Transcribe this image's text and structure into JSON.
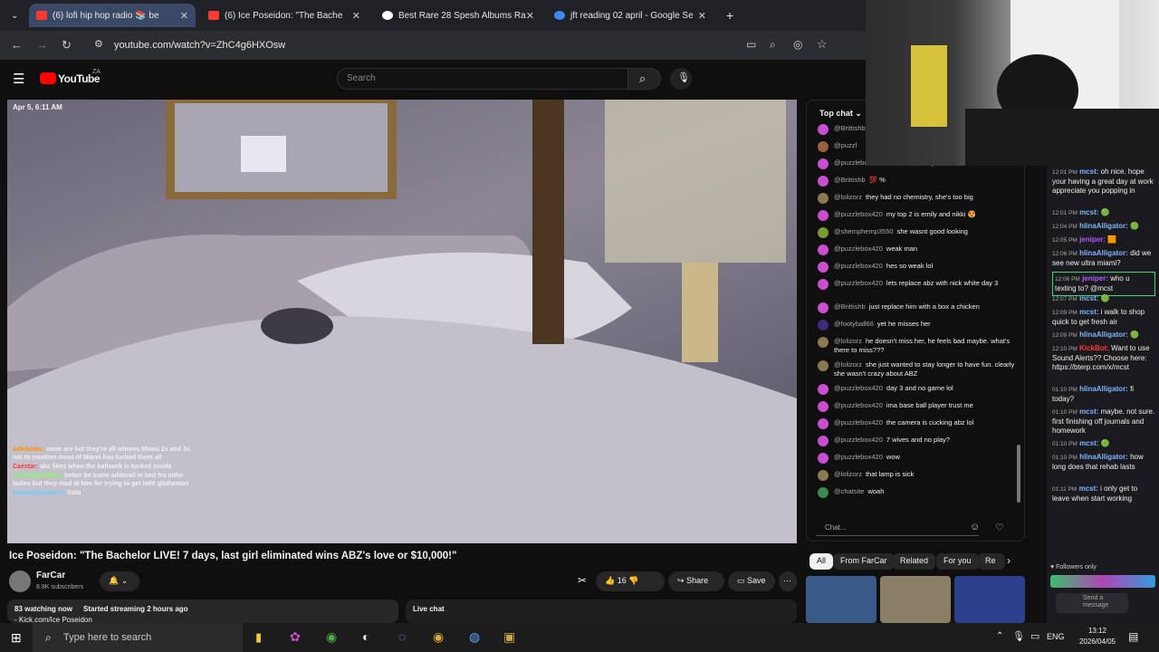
{
  "browser": {
    "tabs": [
      {
        "label": "(6) lofi hip hop radio 📚 be",
        "color": "#ff3b30",
        "active": true
      },
      {
        "label": "(6) Ice Poseidon: \"The Bache",
        "color": "#ff3b30",
        "active": false
      },
      {
        "label": "Best Rare 28 Spesh Albums Ra",
        "color": "#ffffff",
        "active": false
      },
      {
        "label": "jft reading 02 april - Google Se",
        "color": "#4285f4",
        "active": false
      }
    ],
    "url": "youtube.com/watch?v=ZhC4g6HXOsw"
  },
  "youtube": {
    "logo_text": "YouTube",
    "logo_region": "ZA",
    "search_placeholder": "Search"
  },
  "video": {
    "timestamp": "Apr 5, 6:11 AM",
    "overlay_chat": [
      {
        "user": "soleboots:",
        "text": " none are hot they're all whores Miami 2s and 3s not to mention most of Miami has fucked them all",
        "color": "#ff8a00"
      },
      {
        "user": "Caestar:",
        "text": " abz likes when the ballsack is tucked inside",
        "color": "#ff3b3b"
      },
      {
        "user": "TechniquePlays:",
        "text": " better be some adderall in bed fro mthe ladies but they mad at him for trying to get lwht glatheman",
        "color": "#7dff5a"
      },
      {
        "user": "cowboybynature:",
        "text": " Gula",
        "color": "#66ccff"
      }
    ],
    "title": "Ice Poseidon: \"The Bachelor LIVE! 7 days, last girl eliminated wins ABZ's love or $10,000!\"",
    "channel": "FarCar",
    "subscribers": "8.8K subscribers",
    "likes": "16",
    "share_label": "Share",
    "save_label": "Save",
    "watching": "83 watching now",
    "started": "Started streaming 2 hours ago",
    "desc_line": "- Kick.com/Ice Poseidon",
    "live_chat_label": "Live chat"
  },
  "livechat": {
    "header": "Top chat",
    "input_placeholder": "Chat...",
    "messages": [
      {
        "user": "@Brittishb",
        "text": ""
      },
      {
        "user": "@puzzl",
        "text": ""
      },
      {
        "user": "@puzzlebox420",
        "text": "abz is racist af yo"
      },
      {
        "user": "@Brittishb",
        "text": "💯 %"
      },
      {
        "user": "@lolizorz",
        "text": "they had no chemistry, she's too big"
      },
      {
        "user": "@puzzlebox420",
        "text": "my top 2 is emily and nikki 😍"
      },
      {
        "user": "@shemphemp3550",
        "text": "she wasnt good looking"
      },
      {
        "user": "@puzzlebox420",
        "text": "weak man"
      },
      {
        "user": "@puzzlebox420",
        "text": "hes so weak lol"
      },
      {
        "user": "@puzzlebox420",
        "text": "lets replace abz with nick white day 3"
      },
      {
        "user": "@Brittishb",
        "text": "just replace him with a box a chicken"
      },
      {
        "user": "@footyball66",
        "text": "yet he misses her"
      },
      {
        "user": "@lolizorz",
        "text": "he doesn't miss her, he feels bad maybe. what's there to miss???"
      },
      {
        "user": "@lolizorz",
        "text": "she just wanted to stay longer to have fun. clearly she wasn't crazy about ABZ"
      },
      {
        "user": "@puzzlebox420",
        "text": "day 3 and no game lol"
      },
      {
        "user": "@puzzlebox420",
        "text": "ima base ball player trust me"
      },
      {
        "user": "@puzzlebox420",
        "text": "the camera is cucking abz lol"
      },
      {
        "user": "@puzzlebox420",
        "text": "7 wives and no play?"
      },
      {
        "user": "@puzzlebox420",
        "text": "wow"
      },
      {
        "user": "@lolizorz",
        "text": "that lamp is sick"
      },
      {
        "user": "@chatsite",
        "text": "woah"
      }
    ],
    "chips": [
      "All",
      "From FarCar",
      "Related",
      "For you",
      "Re"
    ]
  },
  "streamchat": {
    "lines": [
      {
        "time": "12:01 PM",
        "user": "mcst:",
        "text": " oh nice. hope your having a great day at work appreciate you popping in",
        "color": "#7fb2ff"
      },
      {
        "time": "12:01 PM",
        "user": "mcst:",
        "text": " 🟢",
        "color": "#7fb2ff"
      },
      {
        "time": "12:04 PM",
        "user": "hlinaAlligator:",
        "text": " 🟢",
        "color": "#7fb2ff"
      },
      {
        "time": "12:05 PM",
        "user": "jeniper:",
        "text": " 🟧",
        "color": "#b05cff"
      },
      {
        "time": "12:06 PM",
        "user": "hlinaAlligator:",
        "text": " did we see new ultra miami?",
        "color": "#7fb2ff"
      },
      {
        "time": "12:06 PM",
        "user": "jeniper:",
        "text": " who u texting to? @mcst",
        "color": "#b05cff"
      },
      {
        "time": "12:07 PM",
        "user": "mcst:",
        "text": " 🟢",
        "color": "#7fb2ff"
      },
      {
        "time": "12:09 PM",
        "user": "mcst:",
        "text": " i walk to shop quick to get fresh air",
        "color": "#7fb2ff"
      },
      {
        "time": "12:09 PM",
        "user": "hlinaAlligator:",
        "text": " 🟢",
        "color": "#7fb2ff"
      },
      {
        "time": "12:10 PM",
        "user": "KickBot:",
        "text": " Want to use Sound Alerts?? Choose here: https://bterp.com/x/mcst",
        "color": "#ff3b30"
      },
      {
        "time": "01:10 PM",
        "user": "hlinaAlligator:",
        "text": " fi today?",
        "color": "#7fb2ff"
      },
      {
        "time": "01:10 PM",
        "user": "mcst:",
        "text": " maybe. not sure. first finishing off journals and homework",
        "color": "#7fb2ff"
      },
      {
        "time": "01:10 PM",
        "user": "mcst:",
        "text": " 🟢",
        "color": "#7fb2ff"
      },
      {
        "time": "01:10 PM",
        "user": "hlinaAlligator:",
        "text": " how long does that rehab lasts",
        "color": "#7fb2ff"
      },
      {
        "time": "01:11 PM",
        "user": "mcst:",
        "text": " i only get to leave when start working",
        "color": "#7fb2ff"
      }
    ],
    "followers_only": "Followers only",
    "send_placeholder": "Send a message"
  },
  "taskbar": {
    "search_placeholder": "Type here to search",
    "lang": "ENG",
    "time": "13:12",
    "date": "2026/04/05"
  }
}
